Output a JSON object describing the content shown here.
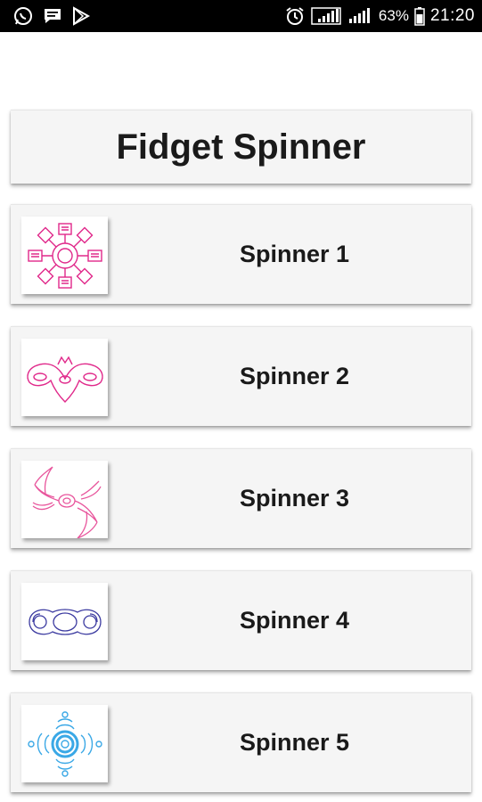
{
  "status_bar": {
    "battery": "63%",
    "time": "21:20",
    "icons": [
      "whatsapp-icon",
      "message-icon",
      "play-store-icon",
      "alarm-icon",
      "signal-icon",
      "signal-icon",
      "battery-icon"
    ]
  },
  "title": "Fidget Spinner",
  "spinners": [
    {
      "label": "Spinner 1",
      "icon": "spinner-1-icon",
      "color": "#e0288a"
    },
    {
      "label": "Spinner 2",
      "icon": "spinner-2-icon",
      "color": "#e0288a"
    },
    {
      "label": "Spinner 3",
      "icon": "spinner-3-icon",
      "color": "#e0288a"
    },
    {
      "label": "Spinner 4",
      "icon": "spinner-4-icon",
      "color": "#3b3aa0"
    },
    {
      "label": "Spinner 5",
      "icon": "spinner-5-icon",
      "color": "#3aa8e6"
    }
  ]
}
